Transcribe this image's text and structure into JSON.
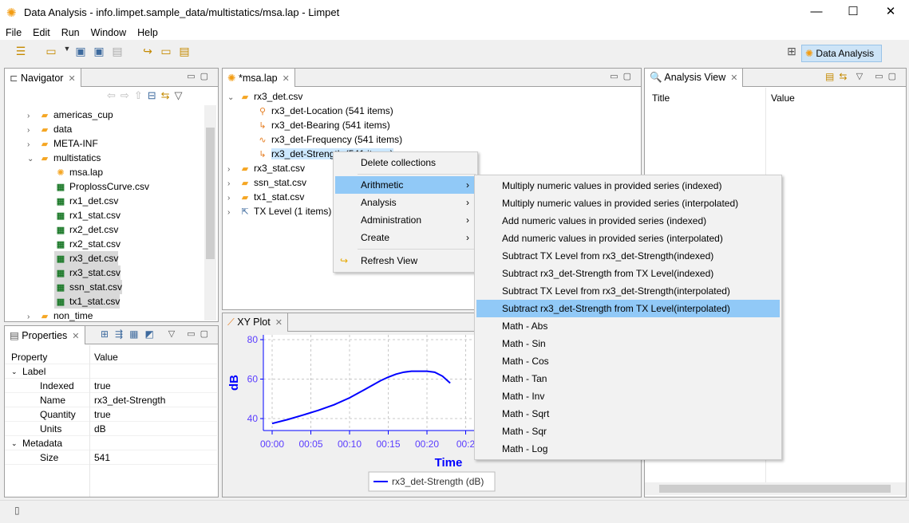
{
  "window": {
    "title": "Data Analysis - info.limpet.sample_data/multistatics/msa.lap - Limpet",
    "minimize": "—",
    "maximize": "☐",
    "close": "✕"
  },
  "menubar": [
    "File",
    "Edit",
    "Run",
    "Window",
    "Help"
  ],
  "perspective": {
    "label": "Data Analysis"
  },
  "navigator": {
    "title": "Navigator",
    "items": [
      {
        "label": "americas_cup",
        "type": "folder",
        "expanded": false,
        "level": 1
      },
      {
        "label": "data",
        "type": "folder",
        "expanded": false,
        "level": 1
      },
      {
        "label": "META-INF",
        "type": "folder",
        "expanded": false,
        "level": 1
      },
      {
        "label": "multistatics",
        "type": "folder",
        "expanded": true,
        "level": 1
      },
      {
        "label": "msa.lap",
        "type": "lap",
        "level": 2
      },
      {
        "label": "ProplossCurve.csv",
        "type": "csv",
        "level": 2
      },
      {
        "label": "rx1_det.csv",
        "type": "csv",
        "level": 2
      },
      {
        "label": "rx1_stat.csv",
        "type": "csv",
        "level": 2
      },
      {
        "label": "rx2_det.csv",
        "type": "csv",
        "level": 2
      },
      {
        "label": "rx2_stat.csv",
        "type": "csv",
        "level": 2
      },
      {
        "label": "rx3_det.csv",
        "type": "csv",
        "level": 2,
        "selected": true
      },
      {
        "label": "rx3_stat.csv",
        "type": "csv",
        "level": 2,
        "selected": true
      },
      {
        "label": "ssn_stat.csv",
        "type": "csv",
        "level": 2,
        "selected": true
      },
      {
        "label": "tx1_stat.csv",
        "type": "csv",
        "level": 2,
        "selected": true
      },
      {
        "label": "non_time",
        "type": "folder",
        "expanded": false,
        "level": 1
      }
    ]
  },
  "properties": {
    "title": "Properties",
    "col_property": "Property",
    "col_value": "Value",
    "rows": [
      {
        "name": "Label",
        "value": "",
        "group": true
      },
      {
        "name": "Indexed",
        "value": "true"
      },
      {
        "name": "Name",
        "value": "rx3_det-Strength"
      },
      {
        "name": "Quantity",
        "value": "true"
      },
      {
        "name": "Units",
        "value": "dB"
      },
      {
        "name": "Metadata",
        "value": "",
        "group": true
      },
      {
        "name": "Size",
        "value": "541"
      }
    ]
  },
  "editor": {
    "title": "*msa.lap",
    "items": [
      {
        "label": "rx3_det.csv",
        "type": "folder",
        "expanded": true,
        "level": 0
      },
      {
        "label": "rx3_det-Location (541 items)",
        "type": "location",
        "level": 1
      },
      {
        "label": "rx3_det-Bearing (541 items)",
        "type": "bearing",
        "level": 1
      },
      {
        "label": "rx3_det-Frequency (541 items)",
        "type": "frequency",
        "level": 1
      },
      {
        "label": "rx3_det-Strength (541 items)",
        "type": "strength",
        "level": 1,
        "selected": true
      },
      {
        "label": "rx3_stat.csv",
        "type": "folder",
        "expanded": false,
        "level": 0
      },
      {
        "label": "ssn_stat.csv",
        "type": "folder",
        "expanded": false,
        "level": 0
      },
      {
        "label": "tx1_stat.csv",
        "type": "folder",
        "expanded": false,
        "level": 0
      },
      {
        "label": "TX Level (1 items)",
        "type": "tx",
        "expanded": false,
        "level": 0
      }
    ]
  },
  "context_menu": {
    "items": [
      "Delete collections",
      "Arithmetic",
      "Analysis",
      "Administration",
      "Create",
      "Refresh View"
    ],
    "highlighted": "Arithmetic"
  },
  "submenu": {
    "items": [
      "Multiply numeric values in provided series (indexed)",
      "Multiply numeric values in provided series (interpolated)",
      "Add numeric values in provided series (indexed)",
      "Add numeric values in provided series (interpolated)",
      "Subtract TX Level from rx3_det-Strength(indexed)",
      "Subtract rx3_det-Strength from TX Level(indexed)",
      "Subtract TX Level from rx3_det-Strength(interpolated)",
      "Subtract rx3_det-Strength from TX Level(interpolated)",
      "Math - Abs",
      "Math - Sin",
      "Math - Cos",
      "Math - Tan",
      "Math - Inv",
      "Math - Sqrt",
      "Math - Sqr",
      "Math - Log"
    ],
    "highlighted_index": 7
  },
  "analysis_view": {
    "title": "Analysis View",
    "col_title": "Title",
    "col_value": "Value"
  },
  "xyplot": {
    "title": "XY Plot"
  },
  "chart_data": {
    "type": "line",
    "xlabel": "Time",
    "ylabel": "dB",
    "ylim": [
      35,
      80
    ],
    "yticks": [
      "40",
      "60",
      "80"
    ],
    "xticks": [
      "00:00",
      "00:05",
      "00:10",
      "00:15",
      "00:20",
      "00:2"
    ],
    "grid": true,
    "legend_placement": "bottom",
    "color": "#0000ff",
    "series": [
      {
        "name": "rx3_det-Strength (dB)",
        "x": [
          0,
          2,
          4,
          6,
          8,
          10,
          12,
          14,
          15,
          16,
          17,
          18,
          19,
          20,
          21,
          22,
          23
        ],
        "y": [
          37.5,
          39.5,
          41.8,
          44.2,
          47,
          50.5,
          54.8,
          59.2,
          61,
          62.5,
          63.5,
          64,
          64,
          64,
          63.5,
          61.5,
          58
        ]
      }
    ]
  }
}
